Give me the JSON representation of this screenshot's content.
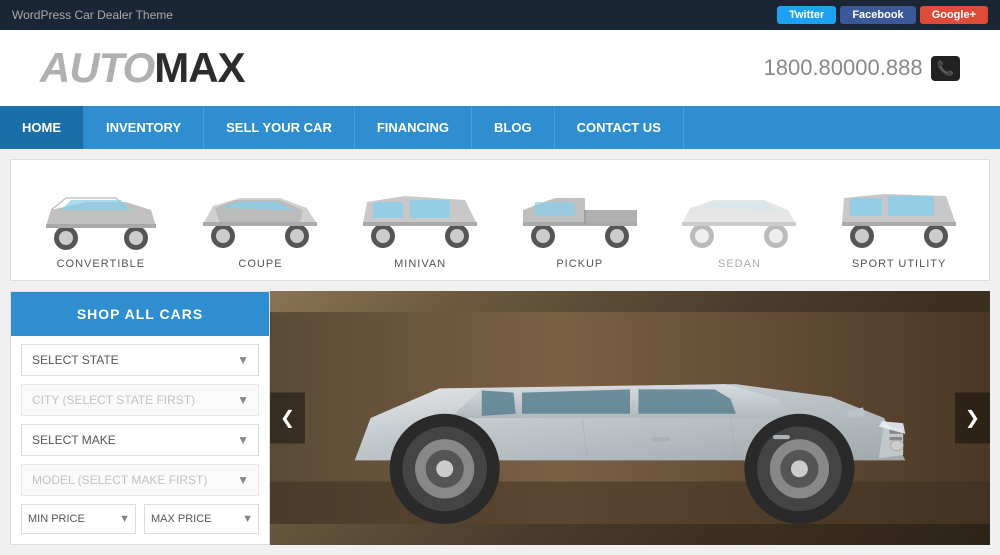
{
  "topbar": {
    "title": "WordPress Car Dealer Theme",
    "twitter": "Twitter",
    "facebook": "Facebook",
    "googleplus": "Google+"
  },
  "header": {
    "logo_auto": "AUTO",
    "logo_max": "MAX",
    "phone": "1800.80000.888"
  },
  "nav": {
    "items": [
      {
        "label": "HOME",
        "active": true
      },
      {
        "label": "INVENTORY",
        "active": false
      },
      {
        "label": "SELL YOUR CAR",
        "active": false
      },
      {
        "label": "FINANCING",
        "active": false
      },
      {
        "label": "BLOG",
        "active": false
      },
      {
        "label": "CONTACT US",
        "active": false
      }
    ]
  },
  "car_types": [
    {
      "label": "CONVERTIBLE",
      "active": false
    },
    {
      "label": "COUPE",
      "active": false
    },
    {
      "label": "MINIVAN",
      "active": false
    },
    {
      "label": "PICKUP",
      "active": false
    },
    {
      "label": "SEDAN",
      "active": true
    },
    {
      "label": "SPORT UTILITY",
      "active": false
    }
  ],
  "sidebar": {
    "shop_all_label": "SHOP ALL CARS",
    "state_placeholder": "SELECT STATE",
    "city_placeholder": "CITY (SELECT STATE FIRST)",
    "make_placeholder": "SELECT MAKE",
    "model_placeholder": "MODEL (SELECT MAKE FIRST)",
    "min_price_label": "MIN PRICE",
    "max_price_label": "MAX PRICE"
  }
}
